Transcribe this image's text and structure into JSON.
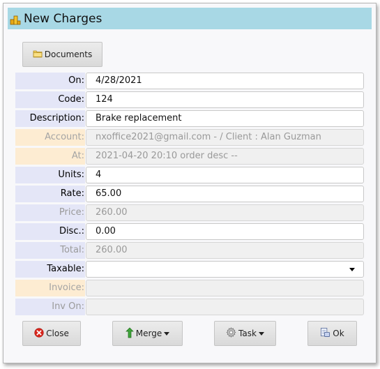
{
  "dialog": {
    "title": "New Charges"
  },
  "toolbar": {
    "documents_label": "Documents"
  },
  "form": {
    "on": {
      "label": "On:",
      "value": "4/28/2021"
    },
    "code": {
      "label": "Code:",
      "value": "124"
    },
    "description": {
      "label": "Description:",
      "value": "Brake replacement"
    },
    "account": {
      "label": "Account:",
      "value": "nxoffice2021@gmail.com -  / Client : Alan Guzman"
    },
    "at": {
      "label": "At:",
      "value": "2021-04-20 20:10 order desc --"
    },
    "units": {
      "label": "Units:",
      "value": "4"
    },
    "rate": {
      "label": "Rate:",
      "value": "65.00"
    },
    "price": {
      "label": "Price:",
      "value": "260.00"
    },
    "disc": {
      "label": "Disc.:",
      "value": "0.00"
    },
    "total": {
      "label": "Total:",
      "value": "260.00"
    },
    "taxable": {
      "label": "Taxable:",
      "value": ""
    },
    "invoice": {
      "label": "Invoice:",
      "value": ""
    },
    "inv_on": {
      "label": "Inv On:",
      "value": ""
    }
  },
  "actions": {
    "close_label": "Close",
    "merge_label": "Merge",
    "task_label": "Task",
    "ok_label": "Ok"
  },
  "colors": {
    "title_bar": "#a8d8e5",
    "label_bg": "#e4e6f7",
    "label_readonly_bg": "#fdecd2",
    "close_icon": "#d9261c"
  },
  "icons": {
    "title": "charges-icon",
    "documents": "folder-icon",
    "close": "close-circle-icon",
    "merge": "merge-arrow-icon",
    "task": "gear-icon",
    "ok": "ok-document-icon"
  }
}
